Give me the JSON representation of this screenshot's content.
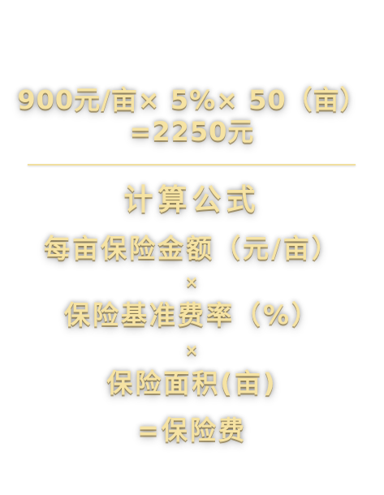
{
  "calculation": {
    "line1": "900元/亩× 5%× 50（亩）",
    "line2": "=2250元"
  },
  "formula": {
    "heading": "计算公式",
    "term1": "每亩保险金额（元/亩）",
    "operator1": "×",
    "term2": "保险基准费率（%）",
    "operator2": "×",
    "term3": "保险面积(亩)",
    "result": "=保险费"
  },
  "colors": {
    "text": "#f6e3a3",
    "divider": "#f1df9f",
    "background": "#ffffff"
  }
}
